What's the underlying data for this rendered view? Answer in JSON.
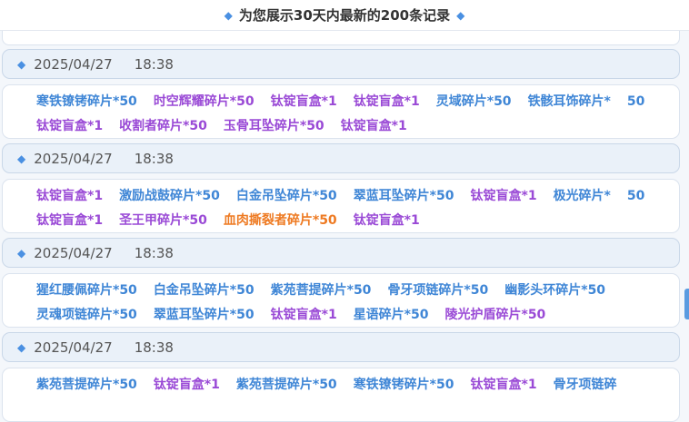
{
  "header": {
    "title": "为您展示30天内最新的200条记录"
  },
  "colors": {
    "blue": "#3f86d6",
    "purple": "#9a4ad6",
    "orange": "#ee7a22"
  },
  "records": [
    {
      "date": "2025/04/27",
      "time": "18:38",
      "items": [
        {
          "text": "寒铁镣铐碎片*50",
          "color": "blue"
        },
        {
          "text": "时空辉耀碎片*50",
          "color": "purple"
        },
        {
          "text": "钛锭盲盒*1",
          "color": "purple"
        },
        {
          "text": "钛锭盲盒*1",
          "color": "purple"
        },
        {
          "text": "灵域碎片*50",
          "color": "blue"
        },
        {
          "text": "铁骸耳饰碎片*",
          "color": "blue"
        },
        {
          "text": "50",
          "color": "blue"
        },
        {
          "text": "钛锭盲盒*1",
          "color": "purple"
        },
        {
          "text": "收割者碎片*50",
          "color": "purple"
        },
        {
          "text": "玉骨耳坠碎片*50",
          "color": "purple"
        },
        {
          "text": "钛锭盲盒*1",
          "color": "purple"
        }
      ]
    },
    {
      "date": "2025/04/27",
      "time": "18:38",
      "items": [
        {
          "text": "钛锭盲盒*1",
          "color": "purple"
        },
        {
          "text": "激励战鼓碎片*50",
          "color": "blue"
        },
        {
          "text": "白金吊坠碎片*50",
          "color": "blue"
        },
        {
          "text": "翠蓝耳坠碎片*50",
          "color": "blue"
        },
        {
          "text": "钛锭盲盒*1",
          "color": "purple"
        },
        {
          "text": "极光碎片*",
          "color": "blue"
        },
        {
          "text": "50",
          "color": "blue"
        },
        {
          "text": "钛锭盲盒*1",
          "color": "purple"
        },
        {
          "text": "圣王甲碎片*50",
          "color": "purple"
        },
        {
          "text": "血肉撕裂者碎片*50",
          "color": "orange"
        },
        {
          "text": "钛锭盲盒*1",
          "color": "purple"
        }
      ]
    },
    {
      "date": "2025/04/27",
      "time": "18:38",
      "items": [
        {
          "text": "猩红腰佩碎片*50",
          "color": "blue"
        },
        {
          "text": "白金吊坠碎片*50",
          "color": "blue"
        },
        {
          "text": "紫苑菩提碎片*50",
          "color": "blue"
        },
        {
          "text": "骨牙项链碎片*50",
          "color": "blue"
        },
        {
          "text": "幽影头环碎片*50",
          "color": "blue"
        },
        {
          "text": "灵魂项链碎片*50",
          "color": "blue"
        },
        {
          "text": "翠蓝耳坠碎片*50",
          "color": "blue"
        },
        {
          "text": "钛锭盲盒*1",
          "color": "purple"
        },
        {
          "text": "星语碎片*50",
          "color": "blue"
        },
        {
          "text": "陵光护盾碎片*50",
          "color": "purple"
        }
      ]
    },
    {
      "date": "2025/04/27",
      "time": "18:38",
      "items": [
        {
          "text": "紫苑菩提碎片*50",
          "color": "blue"
        },
        {
          "text": "钛锭盲盒*1",
          "color": "purple"
        },
        {
          "text": "紫苑菩提碎片*50",
          "color": "blue"
        },
        {
          "text": "寒铁镣铐碎片*50",
          "color": "blue"
        },
        {
          "text": "钛锭盲盒*1",
          "color": "purple"
        },
        {
          "text": "骨牙项链碎",
          "color": "blue"
        }
      ]
    }
  ]
}
